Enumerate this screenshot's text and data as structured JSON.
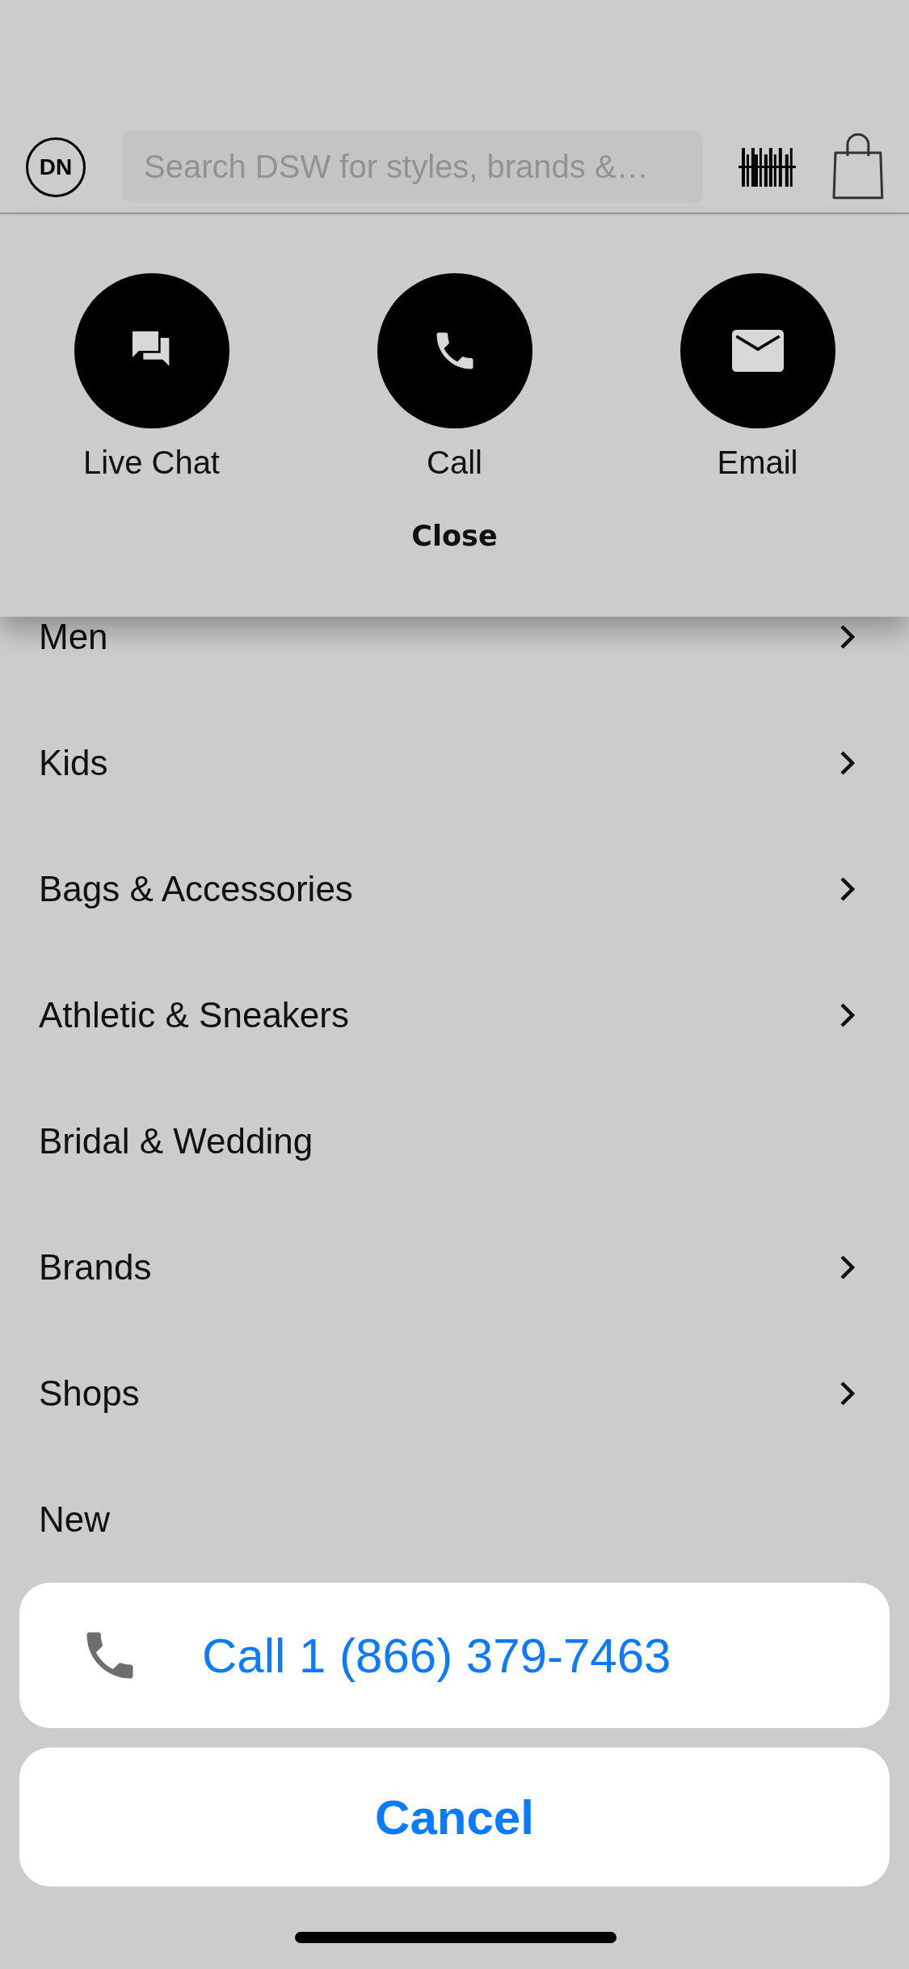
{
  "header": {
    "avatar": "DN",
    "search": {
      "placeholder": "Search DSW for styles, brands &…"
    }
  },
  "contact_panel": {
    "options": [
      {
        "kind": "chat",
        "label": "Live Chat"
      },
      {
        "kind": "call",
        "label": "Call"
      },
      {
        "kind": "email",
        "label": "Email"
      }
    ],
    "close": "Close"
  },
  "menu": {
    "items": [
      {
        "label": "Men",
        "has_submenu": true
      },
      {
        "label": "Kids",
        "has_submenu": true
      },
      {
        "label": "Bags & Accessories",
        "has_submenu": true
      },
      {
        "label": "Athletic & Sneakers",
        "has_submenu": true
      },
      {
        "label": "Bridal & Wedding",
        "has_submenu": false
      },
      {
        "label": "Brands",
        "has_submenu": true
      },
      {
        "label": "Shops",
        "has_submenu": true
      },
      {
        "label": "New",
        "has_submenu": false
      }
    ]
  },
  "action_sheet": {
    "actions": [
      {
        "kind": "call",
        "label": "Call 1 (866) 379-7463"
      }
    ],
    "cancel": "Cancel"
  }
}
